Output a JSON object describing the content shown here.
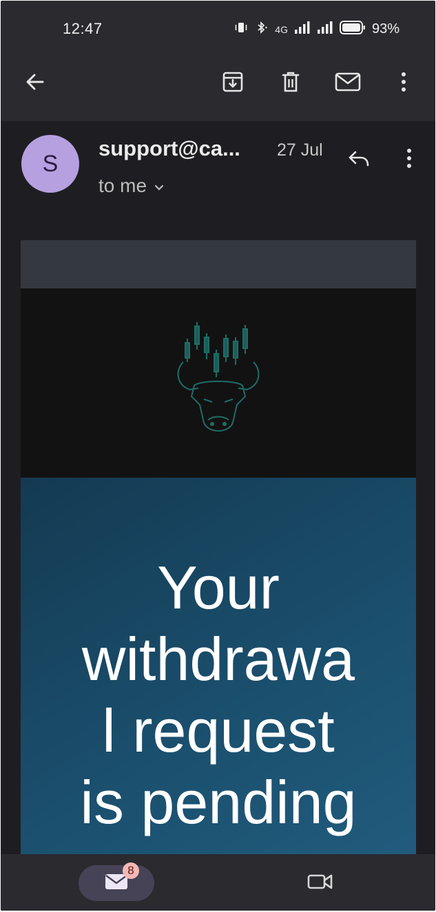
{
  "status_bar": {
    "time": "12:47",
    "network_label": "4G",
    "battery_percent": "93%",
    "icons": [
      "vibrate-icon",
      "bluetooth-icon",
      "signal-icon",
      "signal-icon",
      "battery-icon"
    ]
  },
  "app_bar": {
    "icons": [
      "back-arrow-icon",
      "archive-icon",
      "delete-icon",
      "mark-unread-icon",
      "more-vert-icon"
    ]
  },
  "email": {
    "avatar_letter": "S",
    "sender": "support@ca...",
    "date": "27 Jul",
    "recipient": "to me",
    "hero_title": "Your\nwithdrawa\nl request\nis pending"
  },
  "bottom_nav": {
    "mail_badge": "8",
    "icons": [
      "mail-icon",
      "video-camera-icon"
    ]
  },
  "colors": {
    "avatar": "#b7a0df",
    "logo_accent": "#1f6d68",
    "hero_bg": "#1a4e6c",
    "badge": "#f2b8b5"
  }
}
